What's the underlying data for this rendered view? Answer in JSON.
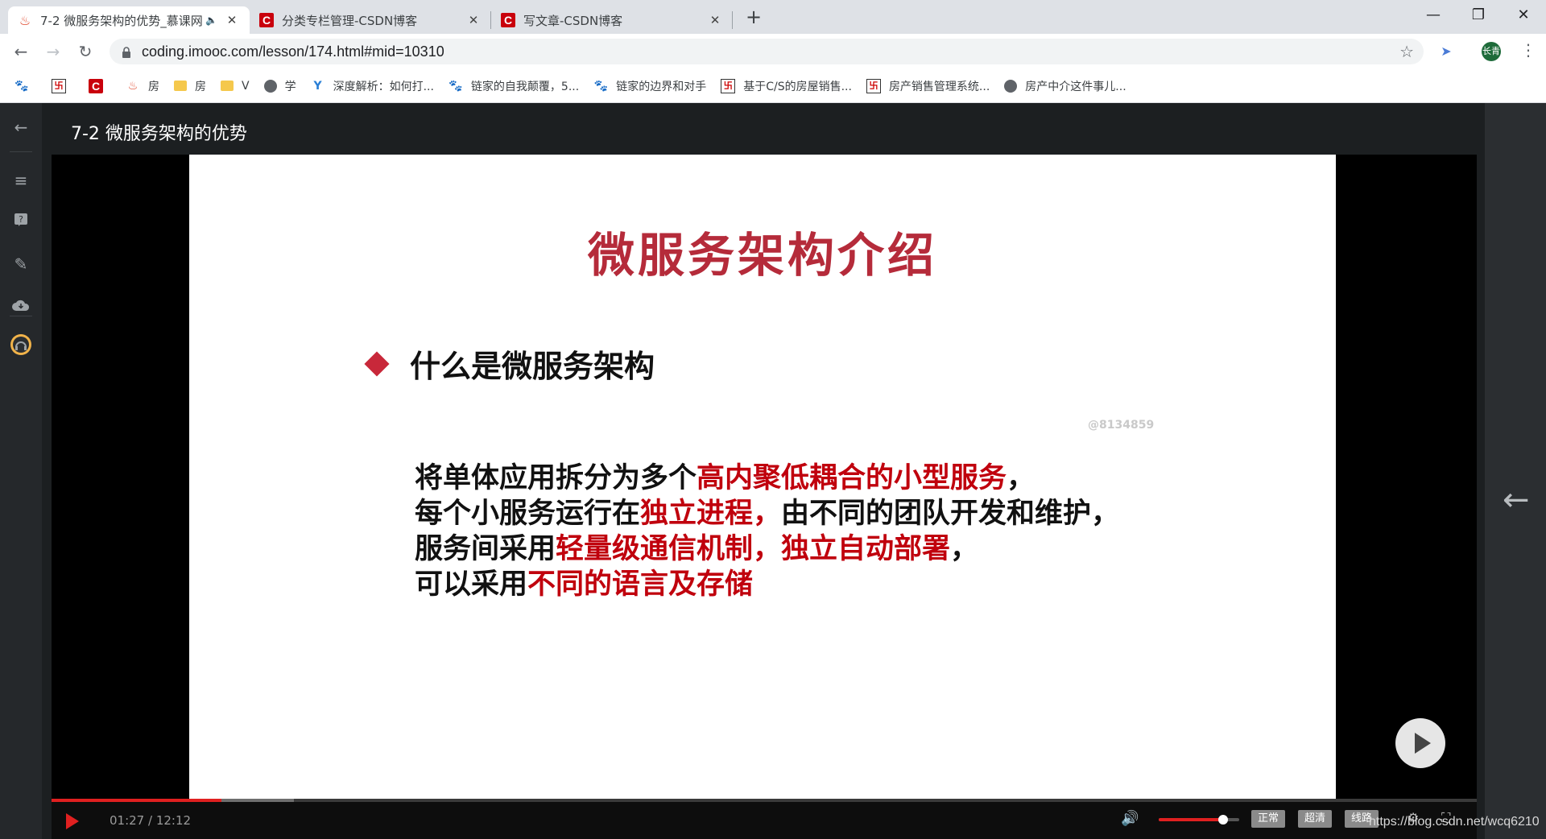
{
  "browser": {
    "tabs": [
      {
        "title": "7-2 微服务架构的优势_慕课网",
        "active": true,
        "audio": true
      },
      {
        "title": "分类专栏管理-CSDN博客",
        "active": false
      },
      {
        "title": "写文章-CSDN博客",
        "active": false
      }
    ],
    "new_tab": "+",
    "window_controls": {
      "minimize": "—",
      "restore": "❐",
      "close": "✕"
    },
    "url": "coding.imooc.com/lesson/174.html#mid=10310",
    "profile_label": "长青",
    "bookmarks": [
      {
        "label": "",
        "icon": "paw-icon"
      },
      {
        "label": "",
        "icon": "chess-icon"
      },
      {
        "label": "",
        "icon": "csdn-icon"
      },
      {
        "label": "房",
        "icon": "fire-icon"
      },
      {
        "label": "房",
        "icon": "folder-icon"
      },
      {
        "label": "V",
        "icon": "folder-icon"
      },
      {
        "label": "学",
        "icon": "globe-icon"
      },
      {
        "label": "深度解析：如何打...",
        "icon": "y-icon"
      },
      {
        "label": "链家的自我颠覆，5...",
        "icon": "paw-icon"
      },
      {
        "label": "链家的边界和对手",
        "icon": "paw-icon"
      },
      {
        "label": "基于C/S的房屋销售...",
        "icon": "chess-icon"
      },
      {
        "label": "房产销售管理系统...",
        "icon": "chess-icon"
      },
      {
        "label": "房产中介这件事儿...",
        "icon": "globe-icon"
      }
    ]
  },
  "player": {
    "lesson_title": "7-2 微服务架构的优势",
    "slide": {
      "title": "微服务架构介绍",
      "bullet": "什么是微服务架构",
      "watermark": "@8134859",
      "lines": [
        [
          {
            "t": "将单体应用拆分为多个",
            "hl": false
          },
          {
            "t": "高内聚低耦合的小型服务",
            "hl": true
          },
          {
            "t": "，",
            "hl": false
          }
        ],
        [
          {
            "t": "每个小服务运行在",
            "hl": false
          },
          {
            "t": "独立进程，",
            "hl": true
          },
          {
            "t": "由不同的团队开发和维护，",
            "hl": false
          }
        ],
        [
          {
            "t": "服务间采用",
            "hl": false
          },
          {
            "t": "轻量级通信机制，独立自动部署",
            "hl": true
          },
          {
            "t": "，",
            "hl": false
          }
        ],
        [
          {
            "t": "可以采用",
            "hl": false
          },
          {
            "t": "不同的语言及存储",
            "hl": true
          }
        ]
      ]
    },
    "time_current": "01:27",
    "time_total": "12:12",
    "time_display": "01:27 / 12:12",
    "progress_fraction": 0.119,
    "buffered_fraction": 0.17,
    "volume_fraction": 0.8,
    "quality_buttons": [
      "正常",
      "超清",
      "线路"
    ],
    "colors": {
      "accent": "#e02020",
      "slide_title": "#b52b3a",
      "highlight": "#c0000d"
    }
  },
  "watermark_text": "https://blog.csdn.net/wcq6210"
}
